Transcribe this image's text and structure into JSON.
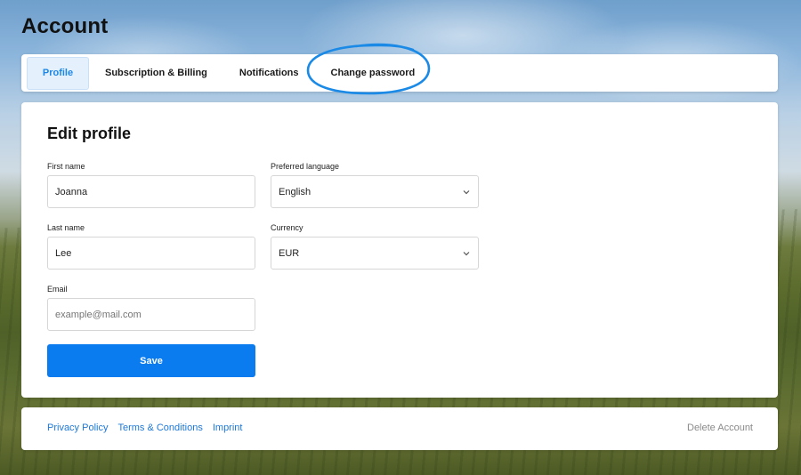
{
  "page": {
    "title": "Account"
  },
  "tabs": [
    {
      "label": "Profile",
      "active": true
    },
    {
      "label": "Subscription & Billing",
      "active": false
    },
    {
      "label": "Notifications",
      "active": false
    },
    {
      "label": "Change password",
      "active": false,
      "highlighted": true
    }
  ],
  "form": {
    "title": "Edit profile",
    "first_name": {
      "label": "First name",
      "value": "Joanna"
    },
    "last_name": {
      "label": "Last name",
      "value": "Lee"
    },
    "email": {
      "label": "Email",
      "placeholder": "example@mail.com"
    },
    "language": {
      "label": "Preferred language",
      "value": "English"
    },
    "currency": {
      "label": "Currency",
      "value": "EUR"
    },
    "save_label": "Save"
  },
  "footer": {
    "links": [
      "Privacy Policy",
      "Terms & Conditions",
      "Imprint"
    ],
    "delete_label": "Delete Account"
  },
  "colors": {
    "accent": "#0a7cf0",
    "active_tab_bg": "#e4f0fc",
    "link": "#1d78d6",
    "highlight_ring": "#1a8ae6"
  },
  "icons": {
    "select_chevron": "chevron-down-icon"
  }
}
